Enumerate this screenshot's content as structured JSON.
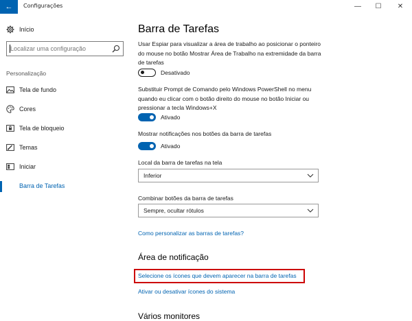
{
  "window": {
    "title": "Configurações",
    "back_glyph": "←",
    "controls": {
      "minimize": "—",
      "maximize": "☐",
      "close": "✕"
    }
  },
  "sidebar": {
    "home_label": "Início",
    "home_icon": "gear-icon",
    "search_placeholder": "Localizar uma configuração",
    "search_icon": "search-icon",
    "section_label": "Personalização",
    "items": [
      {
        "label": "Tela de fundo",
        "icon": "picture-icon"
      },
      {
        "label": "Cores",
        "icon": "palette-icon"
      },
      {
        "label": "Tela de bloqueio",
        "icon": "lock-screen-icon"
      },
      {
        "label": "Temas",
        "icon": "brush-icon"
      },
      {
        "label": "Iniciar",
        "icon": "start-icon"
      },
      {
        "label": "Barra de Tarefas",
        "icon": "taskbar-icon",
        "active": true
      }
    ]
  },
  "main": {
    "title": "Barra de Tarefas",
    "setting1": {
      "description": "Usar Espiar para visualizar a área de trabalho ao posicionar o ponteiro do mouse no botão Mostrar Área de Trabalho na extremidade da barra de tarefas",
      "state": "Desativado",
      "on": false
    },
    "setting2": {
      "description": "Substituir Prompt de Comando pelo Windows PowerShell no menu quando eu clicar com o botão direito do mouse no botão Iniciar ou pressionar a tecla Windows+X",
      "state": "Ativado",
      "on": true
    },
    "setting3": {
      "description": "Mostrar notificações nos botões da barra de tarefas",
      "state": "Ativado",
      "on": true
    },
    "location": {
      "label": "Local da barra de tarefas na tela",
      "value": "Inferior"
    },
    "combine": {
      "label": "Combinar botões da barra de tarefas",
      "value": "Sempre, ocultar rótulos"
    },
    "customize_link": "Como personalizar as barras de tarefas?",
    "notification_area": {
      "title": "Área de notificação",
      "select_icons_link": "Selecione os ícones que devem aparecer na barra de tarefas",
      "system_icons_link": "Ativar ou desativar ícones do sistema"
    },
    "multiple_monitors_title": "Vários monitores"
  },
  "colors": {
    "accent": "#0063b1",
    "highlight_border": "#cc0000"
  }
}
